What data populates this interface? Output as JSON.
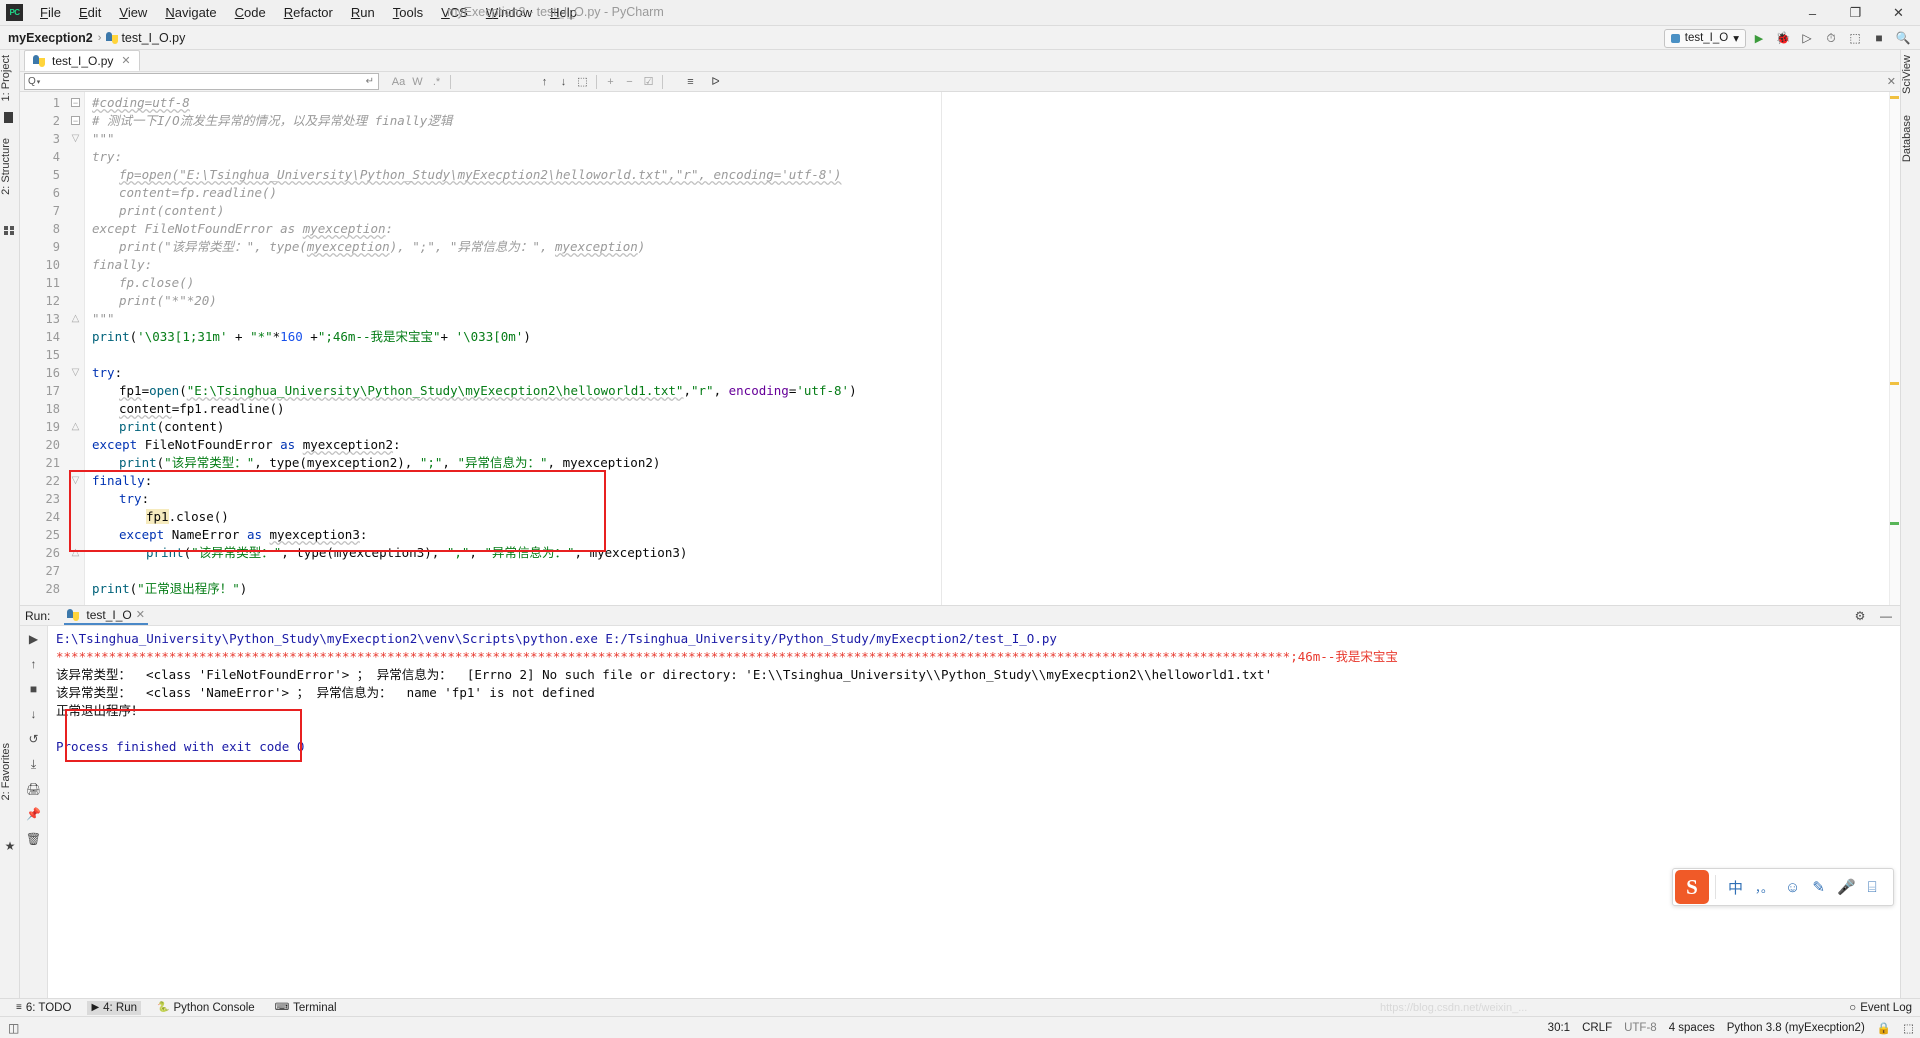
{
  "window": {
    "title": "myExecption2 - test_I_O.py - PyCharm",
    "logo_text": "PC",
    "minimize": "–",
    "maximize": "❐",
    "close": "✕"
  },
  "menu": [
    {
      "label": "File"
    },
    {
      "label": "Edit"
    },
    {
      "label": "View"
    },
    {
      "label": "Navigate"
    },
    {
      "label": "Code"
    },
    {
      "label": "Refactor"
    },
    {
      "label": "Run"
    },
    {
      "label": "Tools"
    },
    {
      "label": "VCS"
    },
    {
      "label": "Window"
    },
    {
      "label": "Help"
    }
  ],
  "breadcrumb": {
    "project": "myExecption2",
    "separator": "›",
    "file": "test_I_O.py"
  },
  "navbar_right": {
    "run_config": "test_I_O",
    "run_config_caret": "▾",
    "run_icon": "▶",
    "debug_icon": "🐞",
    "coverage_icon": "▷",
    "profile_icon": "⏱",
    "attach_icon": "⬚",
    "stop_icon": "■",
    "search_everywhere_icon": "🔍"
  },
  "left_strip": {
    "project_label": "1: Project",
    "structure_label": "2: Structure",
    "favorites_label": "2: Favorites",
    "bookmark_icon": "★"
  },
  "right_strip": {
    "sciview_label": "SciView",
    "database_label": "Database"
  },
  "editor_tab": {
    "label": "test_I_O.py",
    "close": "✕"
  },
  "find_bar": {
    "placeholder": "",
    "value": "",
    "search_icon": "Q",
    "caret_icon": "▾",
    "wrap_icon": "↵",
    "match_case": "Aa",
    "words": "W",
    "regex": ".*",
    "prev_icon": "↑",
    "next_icon": "↓",
    "select_all_icon": "⬚",
    "add_icon": "+",
    "remove_icon": "−",
    "exclude_icon": "☑",
    "sort_icon": "≡",
    "filter_icon": "ᐅ",
    "close_icon": "✕"
  },
  "editor": {
    "first_line": 1,
    "lines": [
      {
        "n": 1,
        "indent": 0,
        "fold": "box",
        "tokens": [
          {
            "t": "#coding=utf-8",
            "c": "c-cmt wavy"
          }
        ]
      },
      {
        "n": 2,
        "indent": 0,
        "fold": "box",
        "tokens": [
          {
            "t": "# 测试一下I/O流发生异常的情况，以及异常处理 finally逻辑",
            "c": "c-cmt"
          }
        ]
      },
      {
        "n": 3,
        "indent": 0,
        "fold": "tipdown",
        "tokens": [
          {
            "t": "\"\"\"",
            "c": "c-cmt"
          }
        ]
      },
      {
        "n": 4,
        "indent": 0,
        "fold": "",
        "tokens": [
          {
            "t": "try:",
            "c": "c-cmt"
          }
        ]
      },
      {
        "n": 5,
        "indent": 1,
        "fold": "",
        "tokens": [
          {
            "t": "fp=open(\"E:\\Tsinghua_University\\Python_Study\\myExecption2\\helloworld.txt\",\"r\", encoding='utf-8')",
            "c": "c-cmt wavy"
          }
        ]
      },
      {
        "n": 6,
        "indent": 1,
        "fold": "",
        "tokens": [
          {
            "t": "content=fp.readline()",
            "c": "c-cmt"
          }
        ]
      },
      {
        "n": 7,
        "indent": 1,
        "fold": "",
        "tokens": [
          {
            "t": "print(content)",
            "c": "c-cmt"
          }
        ]
      },
      {
        "n": 8,
        "indent": 0,
        "fold": "",
        "tokens": [
          {
            "t": "except FileNotFoundError as ",
            "c": "c-cmt"
          },
          {
            "t": "myexception",
            "c": "c-cmt wavy"
          },
          {
            "t": ":",
            "c": "c-cmt"
          }
        ]
      },
      {
        "n": 9,
        "indent": 1,
        "fold": "",
        "tokens": [
          {
            "t": "print(\"该异常类型：\", type(",
            "c": "c-cmt"
          },
          {
            "t": "myexception",
            "c": "c-cmt wavy"
          },
          {
            "t": "), \";\", \"异常信息为：\", ",
            "c": "c-cmt"
          },
          {
            "t": "myexception",
            "c": "c-cmt wavy"
          },
          {
            "t": ")",
            "c": "c-cmt"
          }
        ]
      },
      {
        "n": 10,
        "indent": 0,
        "fold": "",
        "tokens": [
          {
            "t": "finally:",
            "c": "c-cmt"
          }
        ]
      },
      {
        "n": 11,
        "indent": 1,
        "fold": "",
        "tokens": [
          {
            "t": "fp.close()",
            "c": "c-cmt"
          }
        ]
      },
      {
        "n": 12,
        "indent": 1,
        "fold": "",
        "tokens": [
          {
            "t": "print(\"*\"*20)",
            "c": "c-cmt"
          }
        ]
      },
      {
        "n": 13,
        "indent": 0,
        "fold": "tipup",
        "tokens": [
          {
            "t": "\"\"\"",
            "c": "c-cmt"
          }
        ]
      },
      {
        "n": 14,
        "indent": 0,
        "fold": "",
        "tokens": [
          {
            "t": "print",
            "c": "c-fn"
          },
          {
            "t": "(",
            "c": "c-plain"
          },
          {
            "t": "'\\033[1;31m'",
            "c": "c-str"
          },
          {
            "t": " + ",
            "c": "c-plain"
          },
          {
            "t": "\"*\"",
            "c": "c-str"
          },
          {
            "t": "*",
            "c": "c-plain"
          },
          {
            "t": "160",
            "c": "c-num"
          },
          {
            "t": " +",
            "c": "c-plain"
          },
          {
            "t": "\";46m--我是宋宝宝\"",
            "c": "c-str"
          },
          {
            "t": "+ ",
            "c": "c-plain"
          },
          {
            "t": "'\\033[0m'",
            "c": "c-str"
          },
          {
            "t": ")",
            "c": "c-plain"
          }
        ]
      },
      {
        "n": 15,
        "indent": 0,
        "fold": "",
        "tokens": []
      },
      {
        "n": 16,
        "indent": 0,
        "fold": "tipdown",
        "tokens": [
          {
            "t": "try",
            "c": "c-kw"
          },
          {
            "t": ":",
            "c": "c-plain"
          }
        ]
      },
      {
        "n": 17,
        "indent": 1,
        "fold": "",
        "tokens": [
          {
            "t": "fp1",
            "c": "c-plain wavy"
          },
          {
            "t": "=",
            "c": "c-plain"
          },
          {
            "t": "open",
            "c": "c-fn"
          },
          {
            "t": "(",
            "c": "c-plain"
          },
          {
            "t": "\"E:\\Tsinghua_University\\Python_Study\\myExecption2\\helloworld1.txt\"",
            "c": "c-str wavy"
          },
          {
            "t": ",",
            "c": "c-plain"
          },
          {
            "t": "\"r\"",
            "c": "c-str"
          },
          {
            "t": ", ",
            "c": "c-plain"
          },
          {
            "t": "encoding",
            "c": "c-named"
          },
          {
            "t": "=",
            "c": "c-plain"
          },
          {
            "t": "'utf-8'",
            "c": "c-str"
          },
          {
            "t": ")",
            "c": "c-plain"
          }
        ]
      },
      {
        "n": 18,
        "indent": 1,
        "fold": "",
        "tokens": [
          {
            "t": "content",
            "c": "c-plain wavy"
          },
          {
            "t": "=fp1.readline()",
            "c": "c-plain"
          }
        ]
      },
      {
        "n": 19,
        "indent": 1,
        "fold": "tipup",
        "tokens": [
          {
            "t": "print",
            "c": "c-fn"
          },
          {
            "t": "(content)",
            "c": "c-plain"
          }
        ]
      },
      {
        "n": 20,
        "indent": 0,
        "fold": "",
        "tokens": [
          {
            "t": "except ",
            "c": "c-kw"
          },
          {
            "t": "FileNotFoundError",
            "c": "c-plain"
          },
          {
            "t": " as ",
            "c": "c-kw"
          },
          {
            "t": "myexception2",
            "c": "c-plain wavy"
          },
          {
            "t": ":",
            "c": "c-plain"
          }
        ]
      },
      {
        "n": 21,
        "indent": 1,
        "fold": "",
        "tokens": [
          {
            "t": "print",
            "c": "c-fn"
          },
          {
            "t": "(",
            "c": "c-plain"
          },
          {
            "t": "\"该异常类型：\"",
            "c": "c-str"
          },
          {
            "t": ", type(myexception2), ",
            "c": "c-plain"
          },
          {
            "t": "\";\"",
            "c": "c-str"
          },
          {
            "t": ", ",
            "c": "c-plain"
          },
          {
            "t": "\"异常信息为：\"",
            "c": "c-str"
          },
          {
            "t": ", myexception2)",
            "c": "c-plain"
          }
        ]
      },
      {
        "n": 22,
        "indent": 0,
        "fold": "tipdown",
        "tokens": [
          {
            "t": "finally",
            "c": "c-kw"
          },
          {
            "t": ":",
            "c": "c-plain"
          }
        ]
      },
      {
        "n": 23,
        "indent": 1,
        "fold": "",
        "tokens": [
          {
            "t": "try",
            "c": "c-kw"
          },
          {
            "t": ":",
            "c": "c-plain"
          }
        ]
      },
      {
        "n": 24,
        "indent": 2,
        "fold": "",
        "tokens": [
          {
            "t": "fp1",
            "c": "c-plain hl-ident"
          },
          {
            "t": ".close()",
            "c": "c-plain"
          }
        ]
      },
      {
        "n": 25,
        "indent": 1,
        "fold": "",
        "tokens": [
          {
            "t": "except ",
            "c": "c-kw"
          },
          {
            "t": "NameError",
            "c": "c-plain"
          },
          {
            "t": " as ",
            "c": "c-kw"
          },
          {
            "t": "myexception3",
            "c": "c-plain wavy"
          },
          {
            "t": ":",
            "c": "c-plain"
          }
        ]
      },
      {
        "n": 26,
        "indent": 2,
        "fold": "tipup",
        "tokens": [
          {
            "t": "print",
            "c": "c-fn"
          },
          {
            "t": "(",
            "c": "c-plain"
          },
          {
            "t": "\"该异常类型：\"",
            "c": "c-str"
          },
          {
            "t": ", type(myexception3), ",
            "c": "c-plain"
          },
          {
            "t": "\";\"",
            "c": "c-str"
          },
          {
            "t": ", ",
            "c": "c-plain"
          },
          {
            "t": "\"异常信息为：\"",
            "c": "c-str"
          },
          {
            "t": ", myexception3)",
            "c": "c-plain"
          }
        ]
      },
      {
        "n": 27,
        "indent": 0,
        "fold": "",
        "tokens": []
      },
      {
        "n": 28,
        "indent": 0,
        "fold": "",
        "tokens": [
          {
            "t": "print",
            "c": "c-fn"
          },
          {
            "t": "(",
            "c": "c-plain"
          },
          {
            "t": "\"正常退出程序！\"",
            "c": "c-str"
          },
          {
            "t": ")",
            "c": "c-plain"
          }
        ]
      }
    ],
    "annotation_box": {
      "label": "finally-block-highlight"
    }
  },
  "run_panel": {
    "label": "Run:",
    "tab": "test_I_O",
    "tab_close": "✕",
    "settings_icon": "⚙",
    "minimize_icon": "—",
    "toolbar": [
      {
        "icon": "▶",
        "name": "rerun-button"
      },
      {
        "icon": "↑",
        "name": "up-stack-button"
      },
      {
        "icon": "■",
        "name": "stop-button"
      },
      {
        "icon": "↓",
        "name": "down-stack-button"
      },
      {
        "icon": "↺",
        "name": "soft-wrap-button"
      },
      {
        "icon": "⤓",
        "name": "scroll-to-end-button"
      },
      {
        "icon": "🖨",
        "name": "print-button"
      },
      {
        "icon": "📌",
        "name": "pin-tab-button"
      },
      {
        "icon": "🗑",
        "name": "clear-all-button"
      }
    ],
    "output": [
      {
        "text": "E:\\Tsinghua_University\\Python_Study\\myExecption2\\venv\\Scripts\\python.exe E:/Tsinghua_University/Python_Study/myExecption2/test_I_O.py",
        "color": "con-blue"
      },
      {
        "text": "********************************************************************************************************************************************************************;46m--我是宋宝宝",
        "color": "con-red"
      },
      {
        "text": "该异常类型：  <class 'FileNotFoundError'> ； 异常信息为：  [Errno 2] No such file or directory: 'E:\\\\Tsinghua_University\\\\Python_Study\\\\myExecption2\\\\helloworld1.txt'",
        "color": "con-black"
      },
      {
        "text": "该异常类型：  <class 'NameError'> ； 异常信息为：  name 'fp1' is not defined",
        "color": "con-black"
      },
      {
        "text": "正常退出程序！",
        "color": "con-black"
      },
      {
        "text": "",
        "color": "con-black"
      },
      {
        "text": "Process finished with exit code 0",
        "color": "con-blue"
      }
    ]
  },
  "bottom_bar": {
    "windows": [
      {
        "label": "6: TODO",
        "icon": "≡",
        "active": false
      },
      {
        "label": "4: Run",
        "icon": "▶",
        "active": true
      },
      {
        "label": "Python Console",
        "icon": "🐍",
        "active": false
      },
      {
        "label": "Terminal",
        "icon": "⌨",
        "active": false
      }
    ],
    "event_log": "Event Log",
    "event_log_icon": "○"
  },
  "status_bar": {
    "caret": "30:1",
    "line_sep": "CRLF",
    "encoding": "UTF-8",
    "indent": "4 spaces",
    "interpreter": "Python 3.8 (myExecption2)",
    "lock_icon": "🔒",
    "vcs_icon": "⬚"
  },
  "watermark": "https://blog.csdn.net/weixin_...",
  "ime_bar": {
    "logo": "S",
    "mode": "中",
    "punct": "，。",
    "emoji": "☺",
    "pen": "✎",
    "mic": "🎤",
    "grid": "⌸"
  },
  "colors": {
    "accent_blue": "#0033b3",
    "string_green": "#067d17",
    "annotation_red": "#e82020",
    "console_red": "#e8392e",
    "console_blue": "#1a1aa6"
  }
}
